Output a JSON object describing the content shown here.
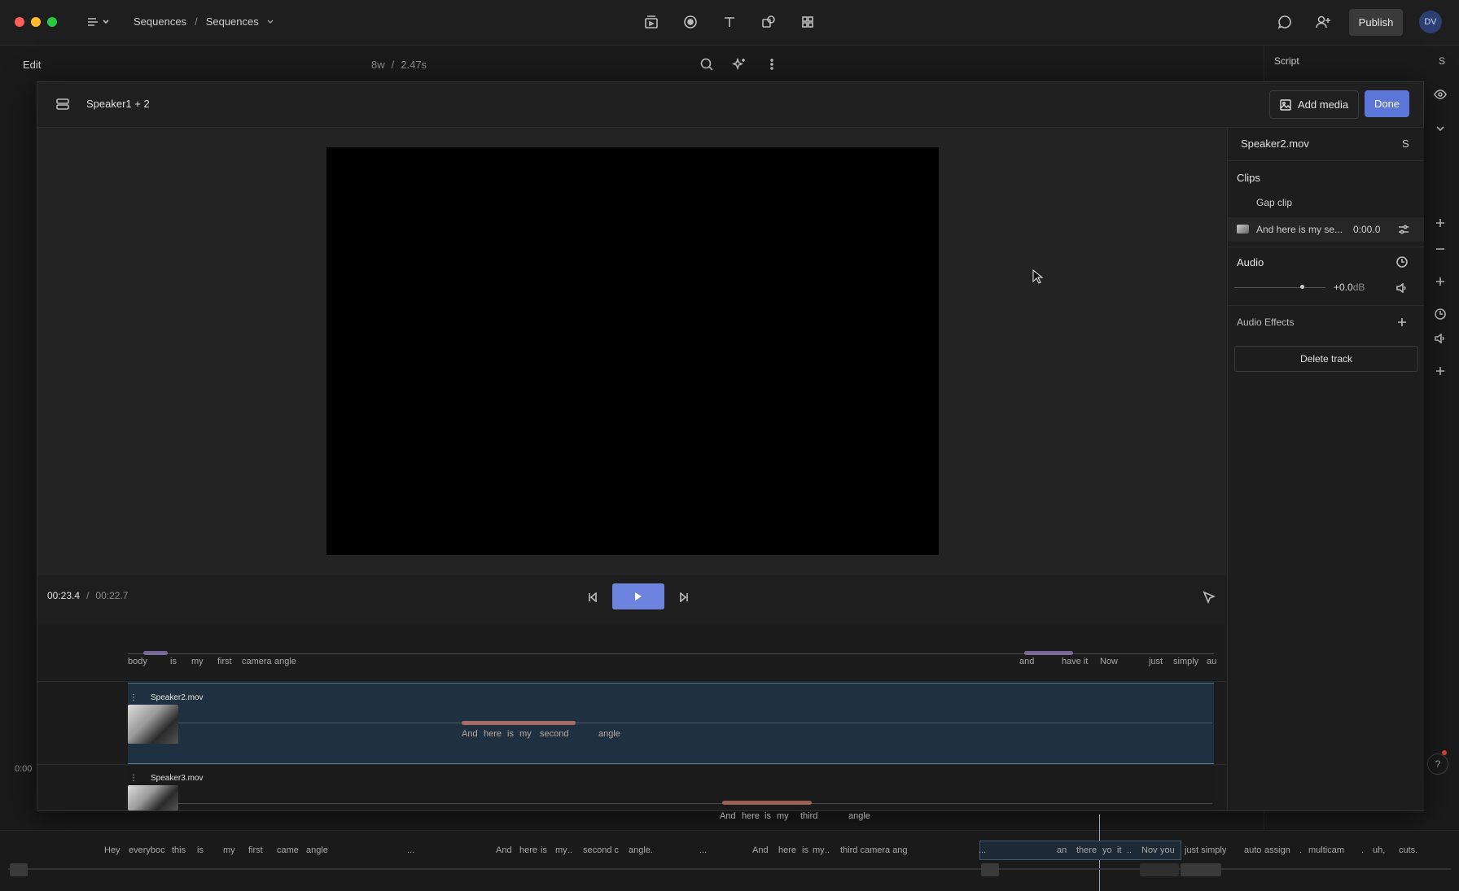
{
  "topbar": {
    "breadcrumb_root": "Sequences",
    "breadcrumb_sep": "/",
    "breadcrumb_current": "Sequences",
    "publish_label": "Publish",
    "avatar_initials": "DV"
  },
  "subbar": {
    "edit_label": "Edit",
    "word_count": "8w",
    "sep": "/",
    "duration": "2.47s"
  },
  "script_panel": {
    "title": "Script",
    "side_letter": "S"
  },
  "modal": {
    "title": "Speaker1 + 2",
    "add_media_label": "Add media",
    "done_label": "Done",
    "time_current": "00:23.4",
    "time_sep": "/",
    "time_total": "00:22.7"
  },
  "inspector": {
    "file_name": "Speaker2.mov",
    "side_letter": "S",
    "clips_heading": "Clips",
    "clips": [
      {
        "label": "Gap clip",
        "time": ""
      },
      {
        "label": "And here is my se...",
        "time": "0:00.0"
      }
    ],
    "audio_heading": "Audio",
    "volume_value": "+0.0",
    "volume_unit": "dB",
    "volume_level": 0.74,
    "audio_effects_heading": "Audio Effects",
    "delete_label": "Delete track"
  },
  "tracks": {
    "main_words": [
      "body",
      "is",
      "my",
      "first",
      "camera",
      "angle",
      "and",
      "have it",
      "Now",
      "just",
      "simply",
      "au"
    ],
    "speaker2": {
      "name": "Speaker2.mov",
      "words": [
        "And",
        "here",
        "is",
        "my",
        "second",
        "angle"
      ]
    },
    "speaker3": {
      "name": "Speaker3.mov",
      "words": [
        "And",
        "here",
        "is",
        "my",
        "third",
        "angle"
      ]
    },
    "left_time": "0:00"
  },
  "bottom_words": [
    "Hey",
    "everyboc",
    "this",
    "is",
    "my",
    "first",
    "came",
    "angle",
    "...",
    "And",
    "here",
    "is",
    "my",
    "..",
    "second c",
    "angle.",
    "...",
    "And",
    "here",
    "is",
    "my",
    "..",
    "third camera ang",
    "...",
    "an",
    "there",
    "yo",
    "it",
    "..",
    "Nov",
    "you",
    "just simply",
    "auto",
    "assign",
    ".",
    "multicam",
    ".",
    "uh,",
    "cuts."
  ],
  "colors": {
    "accent": "#5b76d8",
    "play": "#6c84de",
    "selected_clip": "#1f3140",
    "wave_main": "#9b86c9",
    "wave_clip": "#c77b6a"
  },
  "icons": [
    "sequence-menu-icon",
    "chevron-down-icon",
    "media-icon",
    "record-icon",
    "text-icon",
    "shapes-icon",
    "grid-icon",
    "comment-icon",
    "add-user-icon",
    "search-icon",
    "sparkle-icon",
    "more-icon",
    "layers-icon",
    "image-icon",
    "skip-back-icon",
    "play-icon",
    "skip-forward-icon",
    "cursor-icon",
    "settings-sliders-icon",
    "clock-icon",
    "speaker-icon",
    "plus-icon",
    "eye-icon"
  ]
}
